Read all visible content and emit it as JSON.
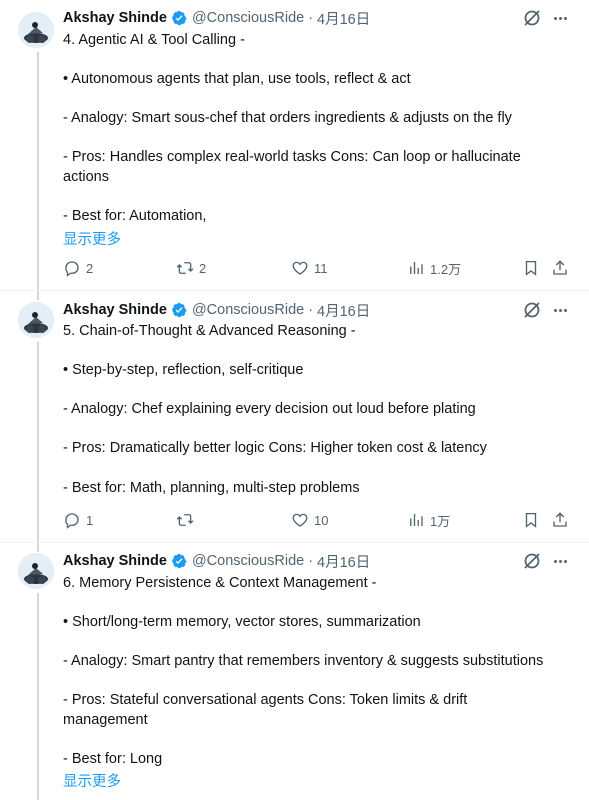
{
  "tweets": [
    {
      "author": "Akshay Shinde",
      "handle": "@ConsciousRide",
      "dot": "·",
      "date": "4月16日",
      "lines": [
        "4. Agentic AI & Tool Calling -",
        "• Autonomous agents that plan, use tools, reflect & act",
        "- Analogy: Smart sous-chef that orders ingredients & adjusts on the fly",
        "- Pros: Handles complex real-world tasks Cons: Can loop or hallucinate",
        "actions",
        "- Best for: Automation,"
      ],
      "show_more": "显示更多",
      "actions": {
        "replies": "2",
        "retweets": "2",
        "likes": "11",
        "views": "1.2万"
      }
    },
    {
      "author": "Akshay Shinde",
      "handle": "@ConsciousRide",
      "dot": "·",
      "date": "4月16日",
      "lines": [
        "5. Chain-of-Thought & Advanced Reasoning -",
        "• Step-by-step, reflection, self-critique",
        "- Analogy: Chef explaining every decision out loud before plating",
        "- Pros: Dramatically better logic Cons: Higher token cost & latency",
        "- Best for: Math, planning, multi-step problems"
      ],
      "show_more": "",
      "actions": {
        "replies": "1",
        "retweets": "",
        "likes": "10",
        "views": "1万"
      }
    },
    {
      "author": "Akshay Shinde",
      "handle": "@ConsciousRide",
      "dot": "·",
      "date": "4月16日",
      "lines": [
        "6. Memory Persistence & Context Management -",
        "• Short/long-term memory, vector stores, summarization",
        "- Analogy: Smart pantry that remembers inventory & suggests substitutions",
        "- Pros: Stateful conversational agents Cons: Token limits & drift",
        "management",
        "- Best for: Long"
      ],
      "show_more": "显示更多",
      "actions": {}
    }
  ],
  "colors": {
    "text": "#0f1419",
    "secondary": "#536471",
    "link": "#1d9bf0",
    "verified": "#1d9bf0",
    "border": "#eff3f4"
  },
  "icons": [
    "verified-badge-icon",
    "grok-icon",
    "more-icon",
    "reply-icon",
    "retweet-icon",
    "like-icon",
    "views-icon",
    "bookmark-icon",
    "share-icon"
  ]
}
